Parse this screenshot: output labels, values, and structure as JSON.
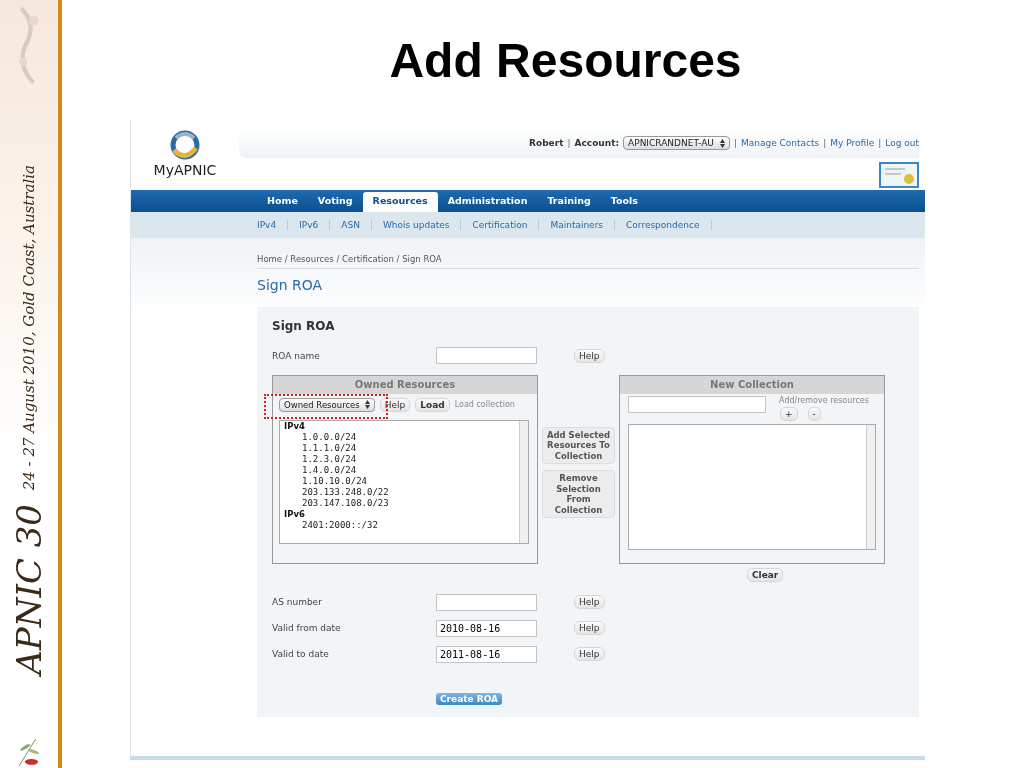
{
  "slide": {
    "event": "APNIC 30",
    "dates": "24 - 27 August 2010, Gold Coast, Australia",
    "title": "Add Resources"
  },
  "header": {
    "logo_text": "MyAPNIC",
    "user_bar": [
      {
        "kind": "name",
        "text": "Robert"
      },
      {
        "kind": "sep",
        "text": "|"
      },
      {
        "kind": "label",
        "text": "Account:"
      },
      {
        "kind": "select",
        "text": "APNICRANDNET-AU"
      },
      {
        "kind": "sep",
        "text": "|"
      },
      {
        "kind": "link",
        "text": "Manage Contacts"
      },
      {
        "kind": "sep",
        "text": "|"
      },
      {
        "kind": "link",
        "text": "My Profile"
      },
      {
        "kind": "sep",
        "text": "|"
      },
      {
        "kind": "link",
        "text": "Log out"
      }
    ]
  },
  "nav": {
    "tabs": [
      {
        "label": "Home",
        "selected": false
      },
      {
        "label": "Voting",
        "selected": false
      },
      {
        "label": "Resources",
        "selected": true
      },
      {
        "label": "Administration",
        "selected": false
      },
      {
        "label": "Training",
        "selected": false
      },
      {
        "label": "Tools",
        "selected": false
      }
    ],
    "subnav": [
      "IPv4",
      "IPv6",
      "ASN",
      "Whois updates",
      "Certification",
      "Maintainers",
      "Correspondence"
    ]
  },
  "breadcrumb": "Home / Resources / Certification / Sign ROA",
  "page_title": "Sign ROA",
  "form": {
    "heading": "Sign ROA",
    "top_fields": [
      {
        "label": "ROA name",
        "help": "Help"
      }
    ],
    "owned": {
      "title": "Owned Resources",
      "select": "Owned Resources",
      "help": "Help",
      "load": "Load",
      "load_label": "Load collection",
      "tree": [
        {
          "label": "IPv4",
          "children": [
            {
              "label": "1.0.0.0/24"
            },
            {
              "label": "1.1.1.0/24"
            },
            {
              "label": "1.2.3.0/24"
            },
            {
              "label": "1.4.0.0/24"
            },
            {
              "label": "1.10.10.0/24"
            },
            {
              "label": "203.133.248.0/22"
            },
            {
              "label": "203.147.108.0/23"
            }
          ]
        },
        {
          "label": "IPv6",
          "children": [
            {
              "label": "2401:2000::/32"
            }
          ]
        }
      ]
    },
    "actions": [
      "Add Selected Resources To Collection",
      "Remove Selection From Collection"
    ],
    "collection": {
      "title": "New Collection",
      "hint": "Add/remove resources",
      "add": "+",
      "remove": "-",
      "clear": "Clear"
    },
    "bottom_fields": [
      {
        "label": "AS number",
        "help": "Help"
      },
      {
        "label": "Valid from date",
        "value": "2010-08-16",
        "help": "Help"
      },
      {
        "label": "Valid to date",
        "value": "2011-08-16",
        "help": "Help"
      }
    ],
    "submit": "Create ROA"
  }
}
